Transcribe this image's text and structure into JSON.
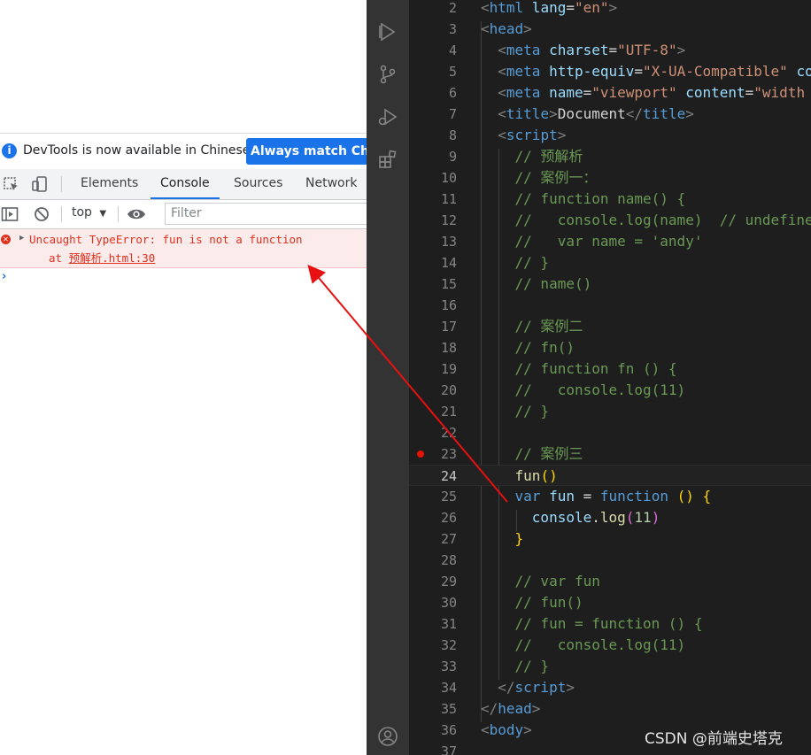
{
  "devtools": {
    "infobar": {
      "text": "DevTools is now available in Chinese!",
      "button": "Always match Chrome's language"
    },
    "tabs": [
      "Elements",
      "Console",
      "Sources",
      "Network"
    ],
    "active_tab": "Console",
    "console_toolbar": {
      "context": "top",
      "filter_placeholder": "Filter"
    },
    "error": {
      "message": "Uncaught TypeError: fun is not a function",
      "stack_prefix": "at ",
      "stack_link": "预解析.html:30"
    },
    "prompt": "›",
    "colors": {
      "accent": "#1a73e8",
      "error": "#e0301e",
      "error_bg": "#fcebeb"
    }
  },
  "editor": {
    "breakpoint_line": 23,
    "current_line": 24,
    "lines": [
      {
        "n": "2",
        "tokens": [
          [
            "<",
            "t"
          ],
          [
            "html",
            "tag"
          ],
          [
            " lang",
            "attr"
          ],
          [
            "=",
            "p"
          ],
          [
            "\"en\"",
            "str"
          ],
          [
            ">",
            "t"
          ]
        ]
      },
      {
        "n": "3",
        "tokens": [
          [
            "<",
            "t"
          ],
          [
            "head",
            "tag"
          ],
          [
            ">",
            "t"
          ]
        ]
      },
      {
        "n": "4",
        "tokens": [
          [
            "  ",
            "p"
          ],
          [
            "<",
            "t"
          ],
          [
            "meta",
            "tag"
          ],
          [
            " charset",
            "attr"
          ],
          [
            "=",
            "p"
          ],
          [
            "\"UTF-8\"",
            "str"
          ],
          [
            ">",
            "t"
          ]
        ]
      },
      {
        "n": "5",
        "tokens": [
          [
            "  ",
            "p"
          ],
          [
            "<",
            "t"
          ],
          [
            "meta",
            "tag"
          ],
          [
            " http-equiv",
            "attr"
          ],
          [
            "=",
            "p"
          ],
          [
            "\"X-UA-Compatible\"",
            "str"
          ],
          [
            " content",
            "attr"
          ]
        ]
      },
      {
        "n": "6",
        "tokens": [
          [
            "  ",
            "p"
          ],
          [
            "<",
            "t"
          ],
          [
            "meta",
            "tag"
          ],
          [
            " name",
            "attr"
          ],
          [
            "=",
            "p"
          ],
          [
            "\"viewport\"",
            "str"
          ],
          [
            " content",
            "attr"
          ],
          [
            "=",
            "p"
          ],
          [
            "\"width",
            "str"
          ]
        ]
      },
      {
        "n": "7",
        "tokens": [
          [
            "  ",
            "p"
          ],
          [
            "<",
            "t"
          ],
          [
            "title",
            "tag"
          ],
          [
            ">",
            "t"
          ],
          [
            "Document",
            "p"
          ],
          [
            "</",
            "t"
          ],
          [
            "title",
            "tag"
          ],
          [
            ">",
            "t"
          ]
        ]
      },
      {
        "n": "8",
        "tokens": [
          [
            "  ",
            "p"
          ],
          [
            "<",
            "t"
          ],
          [
            "script",
            "tag"
          ],
          [
            ">",
            "t"
          ]
        ]
      },
      {
        "n": "9",
        "tokens": [
          [
            "    ",
            "p"
          ],
          [
            "// 预解析",
            "cm"
          ]
        ]
      },
      {
        "n": "10",
        "tokens": [
          [
            "    ",
            "p"
          ],
          [
            "// 案例一：",
            "cm"
          ]
        ]
      },
      {
        "n": "11",
        "tokens": [
          [
            "    ",
            "p"
          ],
          [
            "// function name() {",
            "cm"
          ]
        ]
      },
      {
        "n": "12",
        "tokens": [
          [
            "    ",
            "p"
          ],
          [
            "//   console.log(name)  // undefined",
            "cm"
          ]
        ]
      },
      {
        "n": "13",
        "tokens": [
          [
            "    ",
            "p"
          ],
          [
            "//   var name = 'andy'",
            "cm"
          ]
        ]
      },
      {
        "n": "14",
        "tokens": [
          [
            "    ",
            "p"
          ],
          [
            "// }",
            "cm"
          ]
        ]
      },
      {
        "n": "15",
        "tokens": [
          [
            "    ",
            "p"
          ],
          [
            "// name()",
            "cm"
          ]
        ]
      },
      {
        "n": "16",
        "tokens": []
      },
      {
        "n": "17",
        "tokens": [
          [
            "    ",
            "p"
          ],
          [
            "// 案例二",
            "cm"
          ]
        ]
      },
      {
        "n": "18",
        "tokens": [
          [
            "    ",
            "p"
          ],
          [
            "// fn()",
            "cm"
          ]
        ]
      },
      {
        "n": "19",
        "tokens": [
          [
            "    ",
            "p"
          ],
          [
            "// function fn () {",
            "cm"
          ]
        ]
      },
      {
        "n": "20",
        "tokens": [
          [
            "    ",
            "p"
          ],
          [
            "//   console.log(11)",
            "cm"
          ]
        ]
      },
      {
        "n": "21",
        "tokens": [
          [
            "    ",
            "p"
          ],
          [
            "// }",
            "cm"
          ]
        ]
      },
      {
        "n": "22",
        "tokens": []
      },
      {
        "n": "23",
        "tokens": [
          [
            "    ",
            "p"
          ],
          [
            "// 案例三",
            "cm"
          ]
        ]
      },
      {
        "n": "24",
        "tokens": [
          [
            "    ",
            "p"
          ],
          [
            "fun",
            "fn"
          ],
          [
            "()",
            "br"
          ]
        ]
      },
      {
        "n": "25",
        "tokens": [
          [
            "    ",
            "p"
          ],
          [
            "var",
            "kw"
          ],
          [
            " ",
            "p"
          ],
          [
            "fun",
            "var"
          ],
          [
            " = ",
            "p"
          ],
          [
            "function",
            "kw"
          ],
          [
            " ",
            "p"
          ],
          [
            "()",
            "br"
          ],
          [
            " ",
            "p"
          ],
          [
            "{",
            "br"
          ]
        ]
      },
      {
        "n": "26",
        "tokens": [
          [
            "      ",
            "p"
          ],
          [
            "console",
            "var"
          ],
          [
            ".",
            "p"
          ],
          [
            "log",
            "fn"
          ],
          [
            "(",
            "br2"
          ],
          [
            "11",
            "num"
          ],
          [
            ")",
            "br2"
          ]
        ]
      },
      {
        "n": "27",
        "tokens": [
          [
            "    ",
            "p"
          ],
          [
            "}",
            "br"
          ]
        ]
      },
      {
        "n": "28",
        "tokens": []
      },
      {
        "n": "29",
        "tokens": [
          [
            "    ",
            "p"
          ],
          [
            "// var fun",
            "cm"
          ]
        ]
      },
      {
        "n": "30",
        "tokens": [
          [
            "    ",
            "p"
          ],
          [
            "// fun()",
            "cm"
          ]
        ]
      },
      {
        "n": "31",
        "tokens": [
          [
            "    ",
            "p"
          ],
          [
            "// fun = function () {",
            "cm"
          ]
        ]
      },
      {
        "n": "32",
        "tokens": [
          [
            "    ",
            "p"
          ],
          [
            "//   console.log(11)",
            "cm"
          ]
        ]
      },
      {
        "n": "33",
        "tokens": [
          [
            "    ",
            "p"
          ],
          [
            "// }",
            "cm"
          ]
        ]
      },
      {
        "n": "34",
        "tokens": [
          [
            "  ",
            "p"
          ],
          [
            "</",
            "t"
          ],
          [
            "script",
            "tag"
          ],
          [
            ">",
            "t"
          ]
        ]
      },
      {
        "n": "35",
        "tokens": [
          [
            "</",
            "t"
          ],
          [
            "head",
            "tag"
          ],
          [
            ">",
            "t"
          ]
        ]
      },
      {
        "n": "36",
        "tokens": [
          [
            "<",
            "t"
          ],
          [
            "body",
            "tag"
          ],
          [
            ">",
            "t"
          ]
        ]
      },
      {
        "n": "37",
        "tokens": []
      }
    ],
    "token_colors": {
      "t": "#808080",
      "tag": "#569cd6",
      "attr": "#9cdcfe",
      "str": "#ce9178",
      "p": "#d4d4d4",
      "cm": "#6a9955",
      "kw": "#569cd6",
      "fn": "#dcdcaa",
      "var": "#9cdcfe",
      "num": "#b5cea8",
      "br": "#ffd700",
      "br2": "#da70d6"
    }
  },
  "activity_icons": [
    "explorer-icon",
    "source-control-icon",
    "run-debug-icon",
    "extensions-icon",
    "account-icon"
  ],
  "watermark": "CSDN @前端史塔克"
}
